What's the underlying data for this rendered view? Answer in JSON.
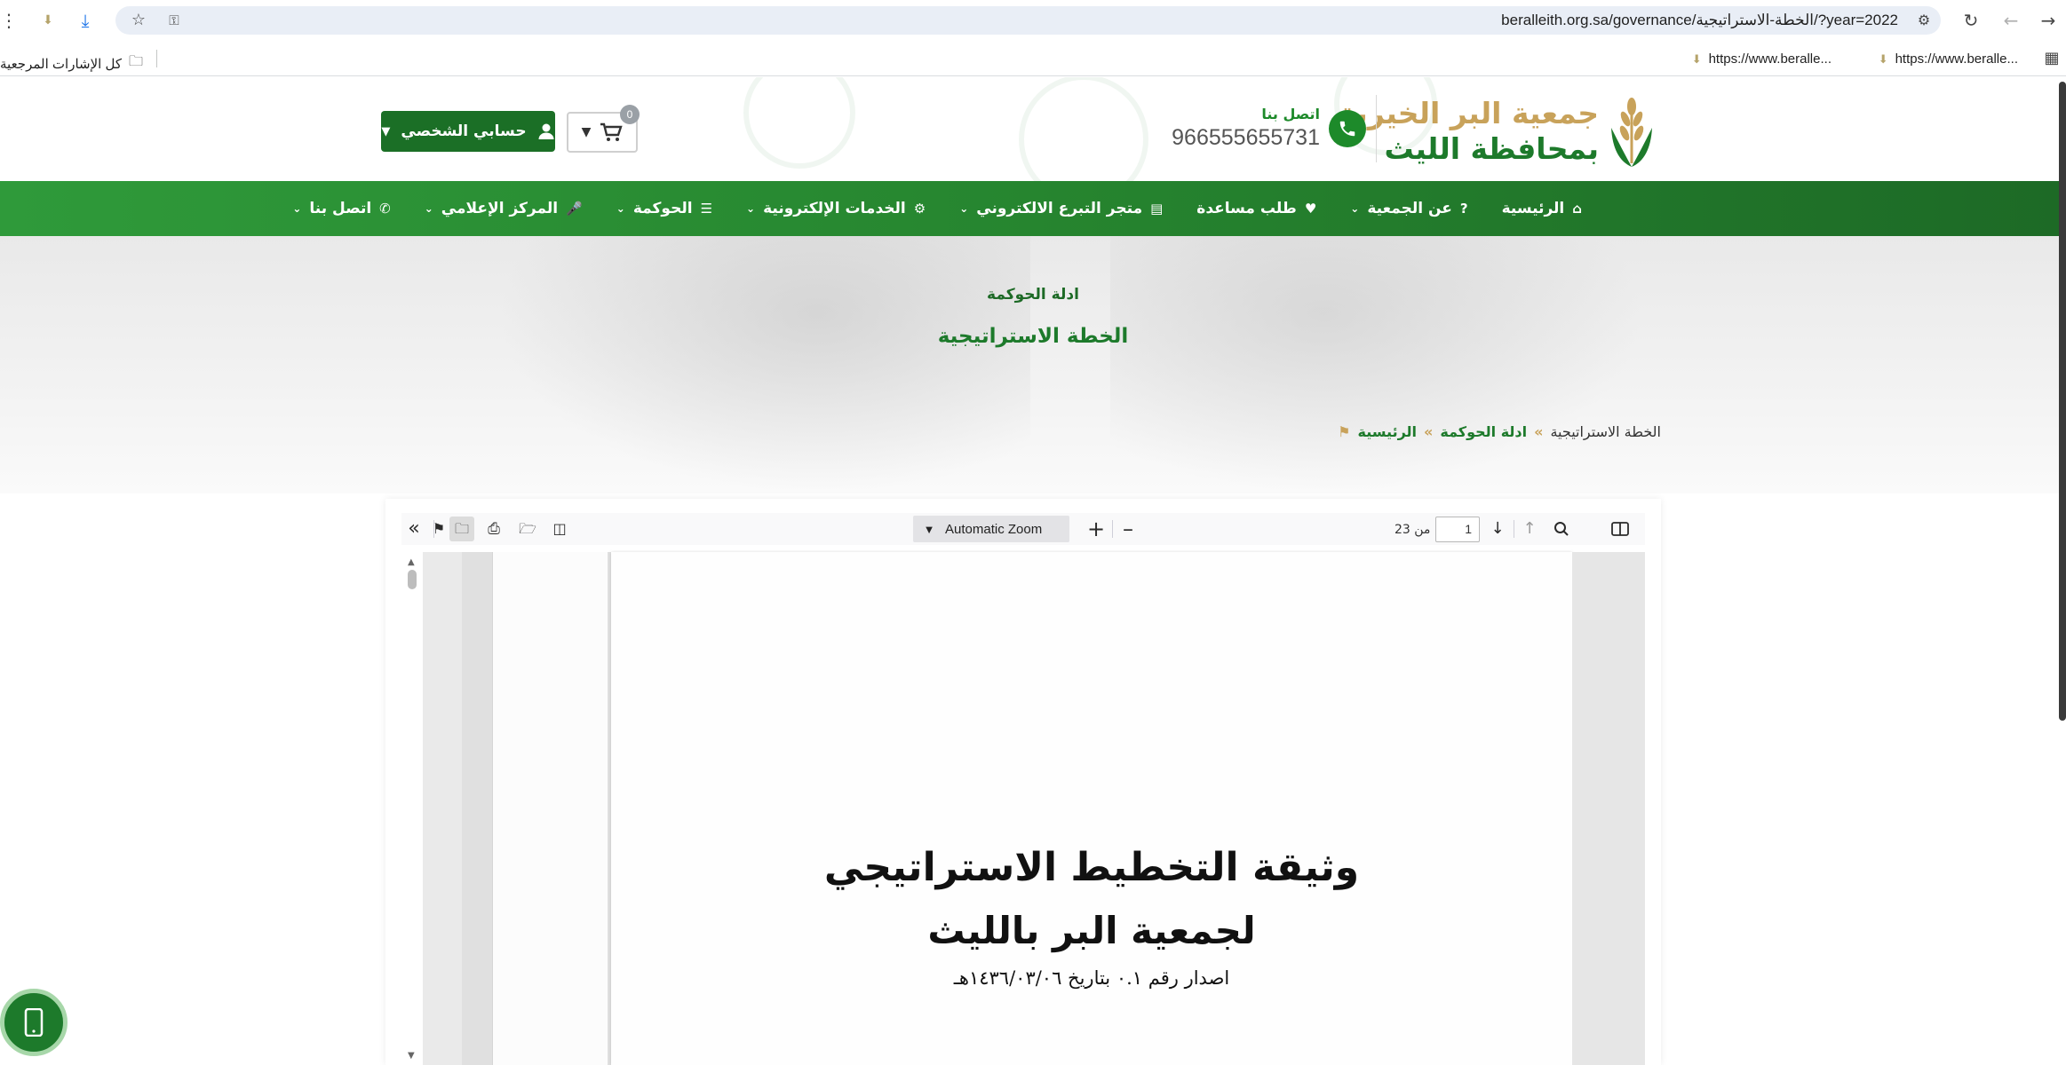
{
  "browser": {
    "url": "beralleith.org.sa/governance/الخطة-الاستراتيجية/?year=2022",
    "bookmarks": [
      {
        "label": "https://www.beralle..."
      },
      {
        "label": "https://www.beralle..."
      }
    ],
    "all_bookmarks_label": "كل الإشارات المرجعية"
  },
  "header": {
    "logo_line1": "جمعية البر الخيرية",
    "logo_line2": "بمحافظة الليث",
    "contact_label": "اتصل بنا",
    "contact_number": "966555655731",
    "cart_count": "0",
    "account_label": "حسابي الشخصي"
  },
  "nav": {
    "items": [
      {
        "label": "الرئيسية",
        "icon": "home-icon",
        "dropdown": false
      },
      {
        "label": "عن الجمعية",
        "icon": "question-icon",
        "dropdown": true
      },
      {
        "label": "طلب مساعدة",
        "icon": "heart-icon",
        "dropdown": false
      },
      {
        "label": "متجر التبرع الالكتروني",
        "icon": "card-icon",
        "dropdown": true
      },
      {
        "label": "الخدمات الإلكترونية",
        "icon": "gears-icon",
        "dropdown": true
      },
      {
        "label": "الحوكمة",
        "icon": "list-icon",
        "dropdown": true
      },
      {
        "label": "المركز الإعلامي",
        "icon": "mic-icon",
        "dropdown": true
      },
      {
        "label": "اتصل بنا",
        "icon": "phone-icon",
        "dropdown": true
      }
    ]
  },
  "hero": {
    "subtitle": "ادلة الحوكمة",
    "title": "الخطة الاستراتيجية"
  },
  "breadcrumb": {
    "home": "الرئيسية",
    "section": "ادلة الحوكمة",
    "current": "الخطة الاستراتيجية",
    "separator": "»"
  },
  "pdf_viewer": {
    "zoom_label": "Automatic Zoom",
    "current_page": "1",
    "total_pages_label": "من 23",
    "document": {
      "heading1": "وثيقة التخطيط الاستراتيجي",
      "heading2": "لجمعية البر بالليث",
      "issue_line": "اصدار رقم ٠.١ بتاريخ ١٤٣٦/٠٣/٠٦هـ"
    }
  },
  "colors": {
    "brand_green": "#1d7a2b",
    "brand_gold": "#c8a25a",
    "nav_green": "#26852f"
  }
}
